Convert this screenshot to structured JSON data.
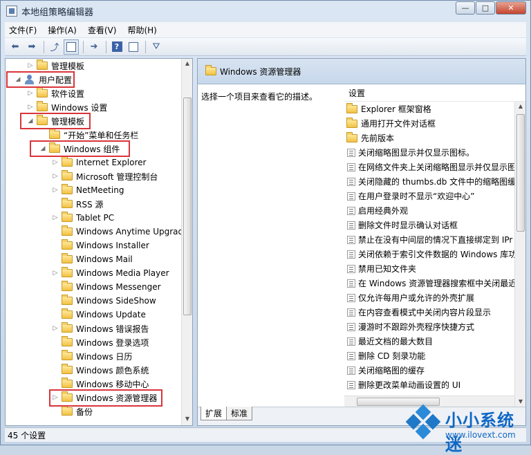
{
  "window": {
    "title": "本地组策略编辑器",
    "buttons": {
      "minimize": "—",
      "maximize": "□",
      "close": "✕"
    }
  },
  "menubar": {
    "items": [
      "文件(F)",
      "操作(A)",
      "查看(V)",
      "帮助(H)"
    ]
  },
  "toolbar": {
    "icons": [
      "back-icon",
      "forward-icon",
      "up-icon",
      "show-hide-tree-icon",
      "export-list-icon",
      "help-icon",
      "properties-icon",
      "filter-icon"
    ]
  },
  "tree": {
    "items": [
      {
        "label": "管理模板",
        "expander": "▷"
      },
      {
        "label": "用户配置",
        "expander": "◢"
      },
      {
        "label": "软件设置",
        "expander": "▷"
      },
      {
        "label": "Windows 设置",
        "expander": "▷"
      },
      {
        "label": "管理模板",
        "expander": "◢"
      },
      {
        "label": "“开始”菜单和任务栏",
        "expander": ""
      },
      {
        "label": "Windows 组件",
        "expander": "◢"
      },
      {
        "label": "Internet Explorer",
        "expander": "▷"
      },
      {
        "label": "Microsoft 管理控制台",
        "expander": "▷"
      },
      {
        "label": "NetMeeting",
        "expander": "▷"
      },
      {
        "label": "RSS 源",
        "expander": ""
      },
      {
        "label": "Tablet PC",
        "expander": "▷"
      },
      {
        "label": "Windows Anytime Upgrade",
        "expander": ""
      },
      {
        "label": "Windows Installer",
        "expander": ""
      },
      {
        "label": "Windows Mail",
        "expander": ""
      },
      {
        "label": "Windows Media Player",
        "expander": "▷"
      },
      {
        "label": "Windows Messenger",
        "expander": ""
      },
      {
        "label": "Windows SideShow",
        "expander": ""
      },
      {
        "label": "Windows Update",
        "expander": ""
      },
      {
        "label": "Windows 错误报告",
        "expander": "▷"
      },
      {
        "label": "Windows 登录选项",
        "expander": ""
      },
      {
        "label": "Windows 日历",
        "expander": ""
      },
      {
        "label": "Windows 颜色系统",
        "expander": ""
      },
      {
        "label": "Windows 移动中心",
        "expander": ""
      },
      {
        "label": "Windows 资源管理器",
        "expander": "▷"
      },
      {
        "label": "备份",
        "expander": ""
      }
    ]
  },
  "right_pane": {
    "header": "Windows 资源管理器",
    "description": "选择一个项目来查看它的描述。",
    "column_header": "设置",
    "settings": [
      {
        "type": "folder",
        "label": "Explorer 框架窗格"
      },
      {
        "type": "folder",
        "label": "通用打开文件对话框"
      },
      {
        "type": "folder",
        "label": "先前版本"
      },
      {
        "type": "policy",
        "label": "关闭缩略图显示并仅显示图标。"
      },
      {
        "type": "policy",
        "label": "在网络文件夹上关闭缩略图显示并仅显示图"
      },
      {
        "type": "policy",
        "label": "关闭隐藏的 thumbs.db 文件中的缩略图缓"
      },
      {
        "type": "policy",
        "label": "在用户登录时不显示“欢迎中心”"
      },
      {
        "type": "policy",
        "label": "启用经典外观"
      },
      {
        "type": "policy",
        "label": "删除文件时显示确认对话框"
      },
      {
        "type": "policy",
        "label": "禁止在没有中间层的情况下直接绑定到 IPr"
      },
      {
        "type": "policy",
        "label": "关闭依赖于索引文件数据的 Windows 库功"
      },
      {
        "type": "policy",
        "label": "禁用已知文件夹"
      },
      {
        "type": "policy",
        "label": "在 Windows 资源管理器搜索框中关闭最近"
      },
      {
        "type": "policy",
        "label": "仅允许每用户或允许的外壳扩展"
      },
      {
        "type": "policy",
        "label": "在内容查看模式中关闭内容片段显示"
      },
      {
        "type": "policy",
        "label": "漫游时不跟踪外壳程序快捷方式"
      },
      {
        "type": "policy",
        "label": "最近文档的最大数目"
      },
      {
        "type": "policy",
        "label": "删除 CD 刻录功能"
      },
      {
        "type": "policy",
        "label": "关闭缩略图的缓存"
      },
      {
        "type": "policy",
        "label": "删除更改菜单动画设置的 UI"
      }
    ],
    "tabs": [
      "扩展",
      "标准"
    ]
  },
  "statusbar": {
    "text": "45 个设置"
  },
  "watermark": {
    "title": "小小系统迷",
    "url": "www.ilovext.com"
  }
}
